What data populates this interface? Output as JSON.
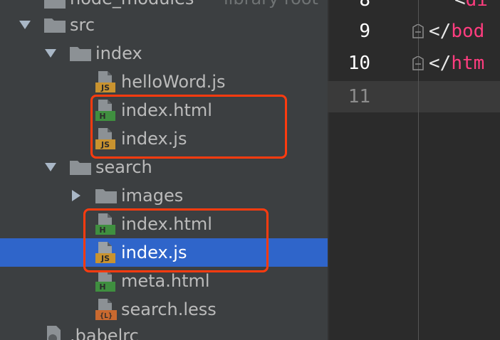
{
  "tree": {
    "top_partial": {
      "label": "node_modules",
      "sub": "library root"
    },
    "items": [
      {
        "name": "src",
        "type": "folder"
      },
      {
        "name": "index",
        "type": "folder"
      },
      {
        "name": "helloWord.js",
        "type": "js"
      },
      {
        "name": "index.html",
        "type": "html"
      },
      {
        "name": "index.js",
        "type": "js"
      },
      {
        "name": "search",
        "type": "folder"
      },
      {
        "name": "images",
        "type": "folder"
      },
      {
        "name": "index.html",
        "type": "html"
      },
      {
        "name": "index.js",
        "type": "js",
        "selected": true
      },
      {
        "name": "meta.html",
        "type": "html"
      },
      {
        "name": "search.less",
        "type": "less"
      }
    ],
    "bottom_partial": {
      "label": ".babelrc"
    }
  },
  "icons": {
    "js_badge": "JS",
    "html_badge": "H",
    "less_badge": "{L}"
  },
  "editor": {
    "lines": [
      {
        "num": "8",
        "code_prefix": "<",
        "code_tag": "di"
      },
      {
        "num": "9",
        "code_prefix": "</",
        "code_tag": "bod"
      },
      {
        "num": "10",
        "code_prefix": "</",
        "code_tag": "htm"
      },
      {
        "num": "11",
        "code_prefix": "",
        "code_tag": ""
      }
    ]
  },
  "colors": {
    "highlight_box": "#ff3b0f",
    "selection": "#2f65ca",
    "tag": "#ff3d7f",
    "js_badge": "#c9932f",
    "html_badge": "#3f8f3f",
    "less_badge": "#c9692f"
  }
}
